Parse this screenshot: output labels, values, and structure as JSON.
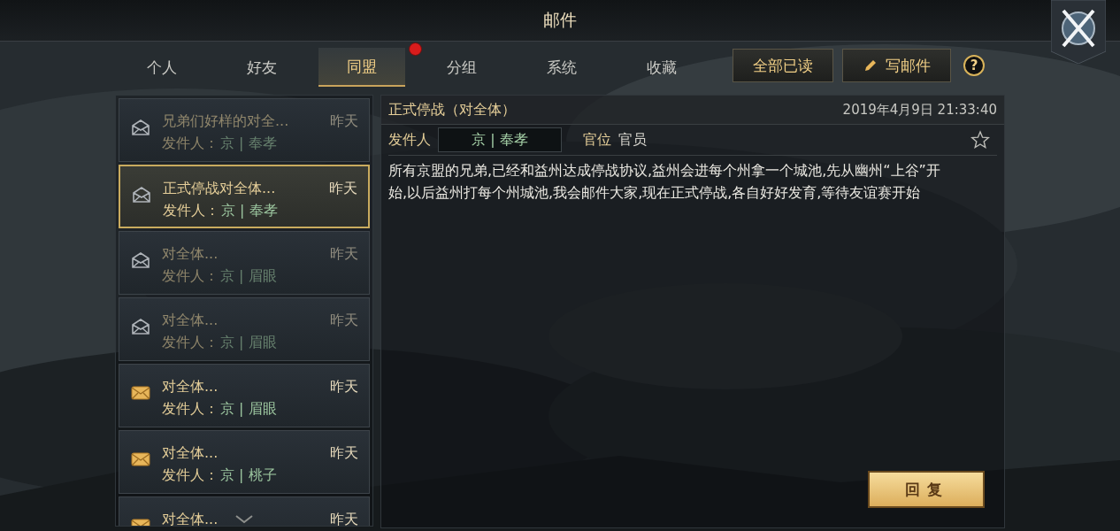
{
  "window": {
    "title": "邮件"
  },
  "tabs": [
    {
      "label": "个人",
      "selected": false,
      "badge": false
    },
    {
      "label": "好友",
      "selected": false,
      "badge": false
    },
    {
      "label": "同盟",
      "selected": true,
      "badge": true
    },
    {
      "label": "分组",
      "selected": false,
      "badge": false
    },
    {
      "label": "系统",
      "selected": false,
      "badge": false
    },
    {
      "label": "收藏",
      "selected": false,
      "badge": false
    }
  ],
  "toolbar": {
    "mark_all_read": "全部已读",
    "compose": "写邮件",
    "help": "?"
  },
  "mails": [
    {
      "title": "兄弟们好样的对全...",
      "time": "昨天",
      "sender_label": "发件人：",
      "sender": "京 | 奉孝",
      "read": true,
      "selected": false
    },
    {
      "title": "正式停战对全体...",
      "time": "昨天",
      "sender_label": "发件人：",
      "sender": "京 | 奉孝",
      "read": true,
      "selected": true
    },
    {
      "title": "对全体...",
      "time": "昨天",
      "sender_label": "发件人：",
      "sender": "京 | 眉眼",
      "read": true,
      "selected": false
    },
    {
      "title": "对全体...",
      "time": "昨天",
      "sender_label": "发件人：",
      "sender": "京 | 眉眼",
      "read": true,
      "selected": false
    },
    {
      "title": "对全体...",
      "time": "昨天",
      "sender_label": "发件人：",
      "sender": "京 | 眉眼",
      "read": false,
      "selected": false
    },
    {
      "title": "对全体...",
      "time": "昨天",
      "sender_label": "发件人：",
      "sender": "京 | 桃子",
      "read": false,
      "selected": false
    },
    {
      "title": "对全体...",
      "time": "昨天",
      "read": false,
      "selected": false
    }
  ],
  "detail": {
    "subject": "正式停战（对全体）",
    "date": "2019年4月9日 21:33:40",
    "sender_label": "发件人",
    "sender": "京 | 奉孝",
    "rank_label": "官位",
    "rank": "官员",
    "favorited": false,
    "body": "所有京盟的兄弟,已经和益州达成停战协议,益州会进每个州拿一个城池,先从幽州“上谷”开始,以后益州打每个州城池,我会邮件大家,现在正式停战,各自好好发育,等待友谊赛开始",
    "reply": "回复"
  }
}
